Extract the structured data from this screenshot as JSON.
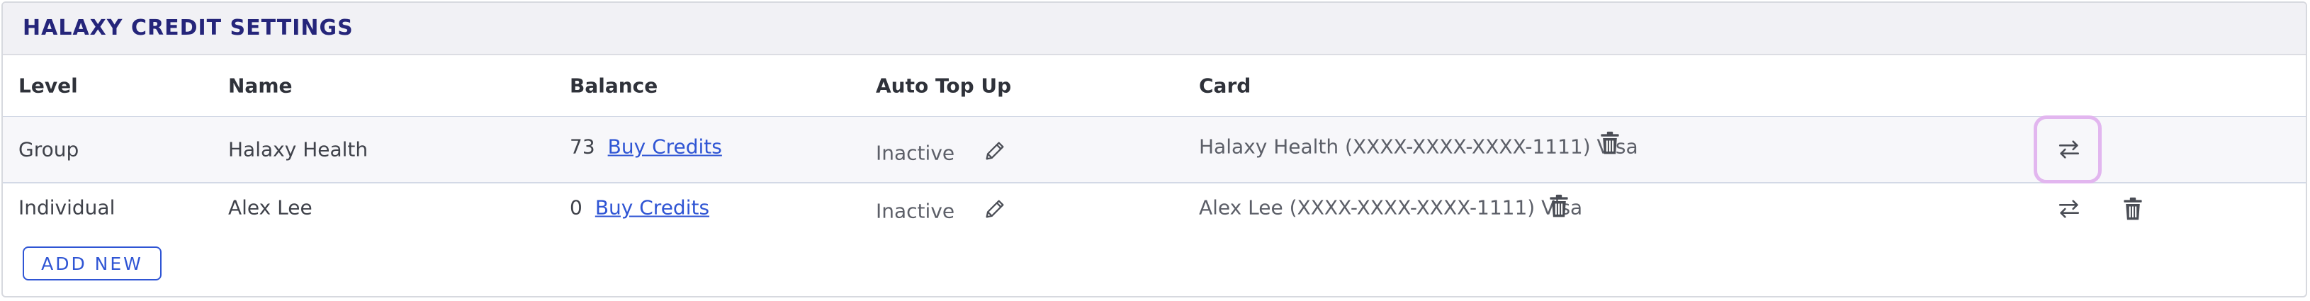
{
  "panel": {
    "title": "HALAXY CREDIT SETTINGS"
  },
  "table": {
    "columns": [
      "Level",
      "Name",
      "Balance",
      "Auto Top Up",
      "Card"
    ],
    "rows": [
      {
        "level": "Group",
        "name": "Halaxy Health",
        "balance": "73",
        "buy_label": "Buy Credits",
        "auto_top_up": "Inactive",
        "card": "Halaxy Health (XXXX-XXXX-XXXX-1111) Visa"
      },
      {
        "level": "Individual",
        "name": "Alex Lee",
        "balance": "0",
        "buy_label": "Buy Credits",
        "auto_top_up": "Inactive",
        "card": "Alex Lee (XXXX-XXXX-XXXX-1111) Visa"
      }
    ]
  },
  "actions": {
    "add_new_label": "ADD NEW"
  },
  "icons": {
    "edit": "pencil-icon",
    "delete": "trash-icon",
    "swap": "swap-arrows-icon"
  },
  "colors": {
    "title": "#25257a",
    "link": "#2f55d4",
    "focus_ring": "#e2b6ef"
  }
}
